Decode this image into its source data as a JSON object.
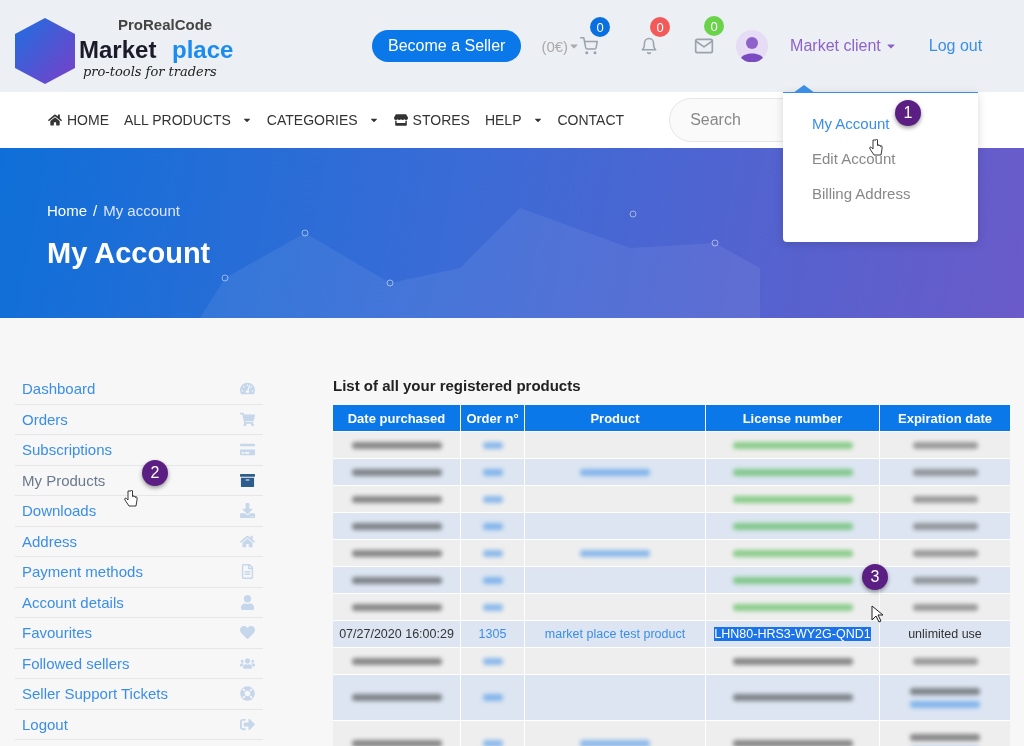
{
  "logo": {
    "brand": "ProRealCode",
    "word1": "Market",
    "word2": "place",
    "tagline": "pro-tools for traders"
  },
  "top_bar": {
    "seller_button": "Become a Seller",
    "cart_total": "(0€)",
    "cart_count": "0",
    "notifications_count": "0",
    "messages_count": "0",
    "user_menu": "Market client",
    "logout": "Log out"
  },
  "nav": {
    "items": [
      {
        "label": "HOME",
        "kind": "home",
        "dropdown": false
      },
      {
        "label": "ALL PRODUCTS",
        "kind": "plain",
        "dropdown": true
      },
      {
        "label": "CATEGORIES",
        "kind": "plain",
        "dropdown": true
      },
      {
        "label": "STORES",
        "kind": "store",
        "dropdown": false
      },
      {
        "label": "HELP",
        "kind": "plain",
        "dropdown": true
      },
      {
        "label": "CONTACT",
        "kind": "plain",
        "dropdown": false
      }
    ],
    "search_placeholder": "Search"
  },
  "user_dropdown": [
    {
      "label": "My Account",
      "selected": true
    },
    {
      "label": "Edit Account",
      "selected": false
    },
    {
      "label": "Billing Address",
      "selected": false
    }
  ],
  "hero": {
    "breadcrumb": [
      "Home",
      "My account"
    ],
    "breadcrumb_separator": "/",
    "title": "My Account"
  },
  "sidebar": [
    {
      "label": "Dashboard",
      "selected": false
    },
    {
      "label": "Orders",
      "selected": false
    },
    {
      "label": "Subscriptions",
      "selected": false
    },
    {
      "label": "My Products",
      "selected": true
    },
    {
      "label": "Downloads",
      "selected": false
    },
    {
      "label": "Address",
      "selected": false
    },
    {
      "label": "Payment methods",
      "selected": false
    },
    {
      "label": "Account details",
      "selected": false
    },
    {
      "label": "Favourites",
      "selected": false
    },
    {
      "label": "Followed sellers",
      "selected": false
    },
    {
      "label": "Seller Support Tickets",
      "selected": false
    },
    {
      "label": "Logout",
      "selected": false
    }
  ],
  "table": {
    "title": "List of all your registered products",
    "columns": [
      "Date purchased",
      "Order n°",
      "Product",
      "License number",
      "Expiration date"
    ],
    "rows": [
      {
        "kind": "blurred"
      },
      {
        "kind": "blurred"
      },
      {
        "kind": "blurred"
      },
      {
        "kind": "blurred"
      },
      {
        "kind": "blurred"
      },
      {
        "kind": "blurred"
      },
      {
        "kind": "blurred"
      },
      {
        "kind": "clear",
        "date": "07/27/2020 16:00:29",
        "order": "1305",
        "product": "market place test product",
        "license": "LHN80-HRS3-WY2G-QND1",
        "license_selected": true,
        "expiration": "unlimited use"
      },
      {
        "kind": "blurred"
      },
      {
        "kind": "blurred_tall"
      },
      {
        "kind": "blurred_tall"
      }
    ]
  },
  "callouts": [
    "1",
    "2",
    "3"
  ]
}
